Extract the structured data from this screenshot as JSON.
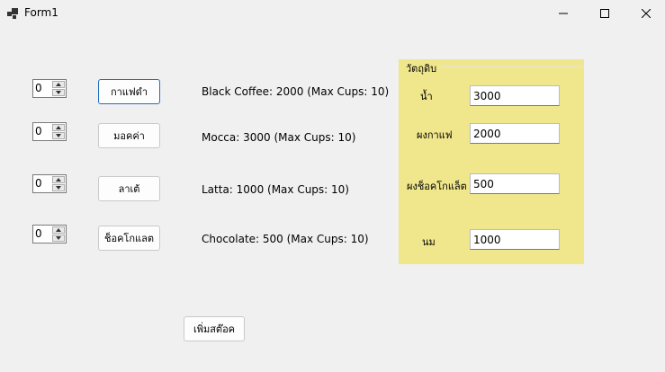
{
  "window": {
    "title": "Form1",
    "icon": "app-icon"
  },
  "menu": [
    {
      "qty": "0",
      "button": "กาแฟดำ",
      "desc": "Black Coffee: 2000 (Max Cups: 10)"
    },
    {
      "qty": "0",
      "button": "มอคค่า",
      "desc": "Mocca: 3000 (Max Cups: 10)"
    },
    {
      "qty": "0",
      "button": "ลาเต้",
      "desc": "Latta: 1000 (Max Cups: 10)"
    },
    {
      "qty": "0",
      "button": "ช็อคโกแลต",
      "desc": "Chocolate: 500 (Max Cups: 10)"
    }
  ],
  "ingredients": {
    "title": "วัตถุดิบ",
    "items": [
      {
        "label": "น้ำ",
        "value": "3000"
      },
      {
        "label": "ผงกาแฟ",
        "value": "2000"
      },
      {
        "label": "ผงช็อคโกแล็ต",
        "value": "500"
      },
      {
        "label": "นม",
        "value": "1000"
      }
    ]
  },
  "add_stock_button": "เพิ่มสต๊อค",
  "colors": {
    "group_bg": "#f0e68c",
    "default_border": "#1f6fbf",
    "window_bg": "#f0f0f0"
  }
}
